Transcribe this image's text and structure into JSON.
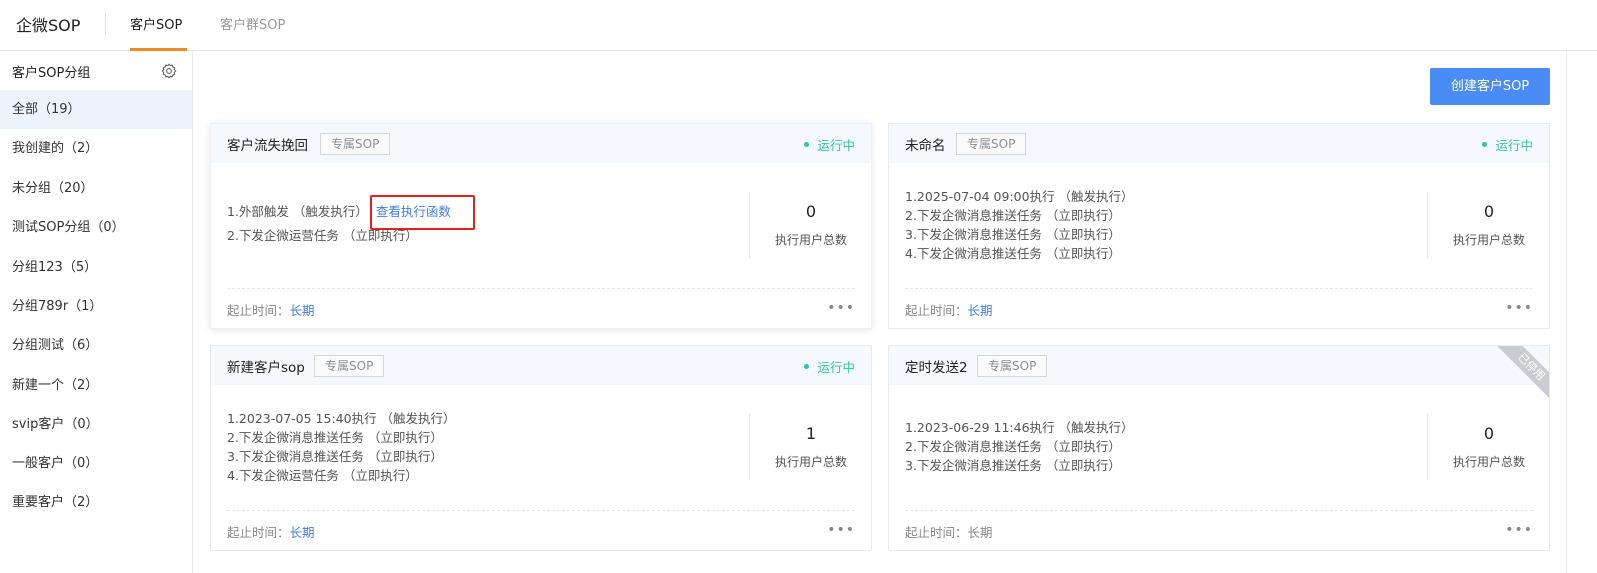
{
  "app": {
    "title": "企微SOP"
  },
  "tabs": [
    {
      "label": "客户SOP",
      "active": true
    },
    {
      "label": "客户群SOP",
      "active": false
    }
  ],
  "sidebar": {
    "title": "客户SOP分组",
    "items": [
      {
        "label": "全部（19）",
        "active": true
      },
      {
        "label": "我创建的（2）"
      },
      {
        "label": "未分组（20）"
      },
      {
        "label": "测试SOP分组（0）"
      },
      {
        "label": "分组123（5）"
      },
      {
        "label": "分组789r（1）"
      },
      {
        "label": "分组测试（6）"
      },
      {
        "label": "新建一个（2）"
      },
      {
        "label": "svip客户（0）"
      },
      {
        "label": "一般客户（0）"
      },
      {
        "label": "重要客户（2）"
      }
    ]
  },
  "toolbar": {
    "create_label": "创建客户SOP"
  },
  "labels": {
    "metric_label": "执行用户总数",
    "period_label": "起止时间：",
    "more": "•••"
  },
  "cards": [
    {
      "name": "客户流失挽回",
      "tag": "专属SOP",
      "status": "运行中",
      "steps": [
        "1.外部触发 （触发执行）",
        "2.下发企微运营任务 （立即执行）"
      ],
      "link": "查看执行函数",
      "count": "0",
      "period": "长期"
    },
    {
      "name": "未命名",
      "tag": "专属SOP",
      "status": "运行中",
      "steps": [
        "1.2025-07-04 09:00执行 （触发执行）",
        "2.下发企微消息推送任务 （立即执行）",
        "3.下发企微消息推送任务 （立即执行）",
        "4.下发企微消息推送任务 （立即执行）"
      ],
      "count": "0",
      "period": "长期"
    },
    {
      "name": "新建客户sop",
      "tag": "专属SOP",
      "status": "运行中",
      "steps": [
        "1.2023-07-05 15:40执行 （触发执行）",
        "2.下发企微消息推送任务 （立即执行）",
        "3.下发企微消息推送任务 （立即执行）",
        "4.下发企微运营任务 （立即执行）"
      ],
      "count": "1",
      "period": "长期"
    },
    {
      "name": "定时发送2",
      "tag": "专属SOP",
      "ribbon": "已停用",
      "steps": [
        "1.2023-06-29 11:46执行 （触发执行）",
        "2.下发企微消息推送任务 （立即执行）",
        "3.下发企微消息推送任务 （立即执行）"
      ],
      "count": "0",
      "period": "长期"
    }
  ],
  "colors": {
    "accent": "#4a8bf5",
    "link": "#3f7ef0",
    "running": "#2ec7a4",
    "tab_underline": "#f08a24",
    "highlight_box": "#e8201c"
  }
}
